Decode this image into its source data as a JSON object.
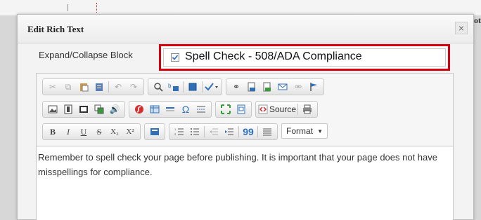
{
  "window": {
    "title": "Edit Rich Text",
    "close_glyph": "×"
  },
  "backdrop": {
    "edge_text": "ot"
  },
  "form": {
    "field_label": "Expand/Collapse Block",
    "field_value": "Spell Check - 508/ADA Compliance",
    "checkbox_checked": true
  },
  "toolbar": {
    "source_label": "Source",
    "format_label": "Format",
    "bold_label": "B",
    "italic_label": "I",
    "underline_label": "U",
    "strike_label": "S",
    "subscript_label": "X₂",
    "superscript_label": "X²",
    "quote_label": "99"
  },
  "editor": {
    "content": "Remember to spell check your page before publishing. It is important that your page does not have misspellings for compliance."
  },
  "colors": {
    "highlight_border": "#d9000d",
    "dialog_bg": "#f3f3f3",
    "icon_blue": "#2f6fb8",
    "icon_red": "#d32f2f",
    "icon_green": "#3a9b3a"
  }
}
